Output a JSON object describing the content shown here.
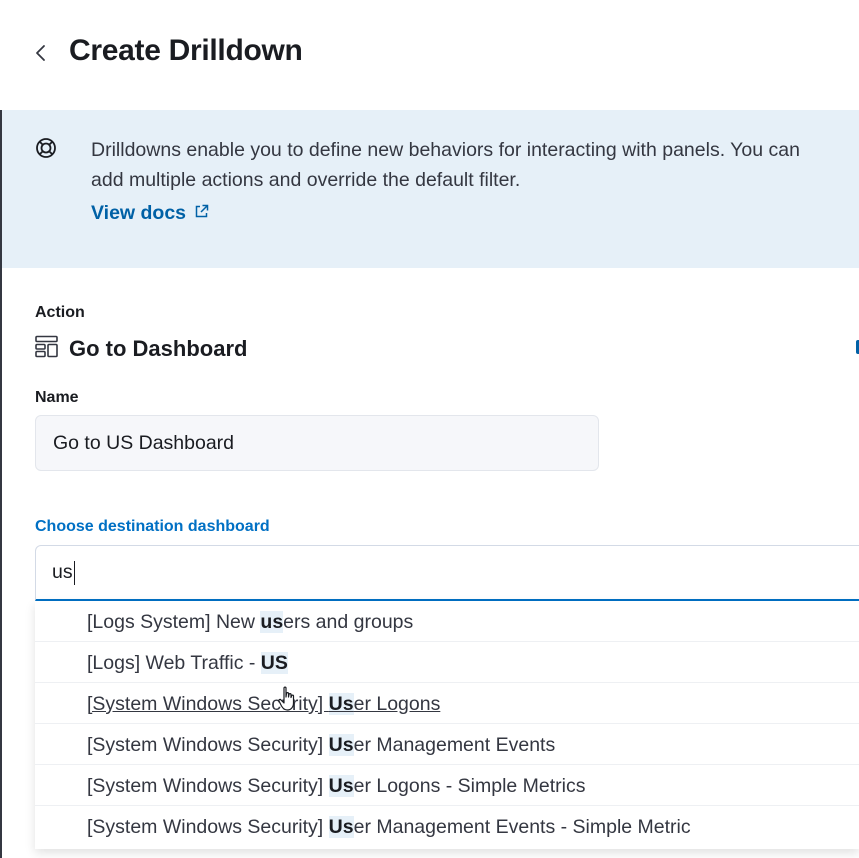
{
  "header": {
    "title": "Create Drilldown"
  },
  "callout": {
    "text": "Drilldowns enable you to define new behaviors for interacting with panels. You can add multiple actions and override the default filter.",
    "link_label": "View docs"
  },
  "action": {
    "label": "Action",
    "name": "Go to Dashboard"
  },
  "name_field": {
    "label": "Name",
    "value": "Go to US Dashboard"
  },
  "destination": {
    "label": "Choose destination dashboard",
    "search_value": "us",
    "options": [
      {
        "prefix": "[Logs System] New ",
        "match": "us",
        "suffix": "ers and groups"
      },
      {
        "prefix": "[Logs] Web Traffic - ",
        "match": "US",
        "suffix": ""
      },
      {
        "prefix": "[System Windows Security] ",
        "match": "Us",
        "suffix": "er Logons"
      },
      {
        "prefix": "[System Windows Security] ",
        "match": "Us",
        "suffix": "er Management Events"
      },
      {
        "prefix": "[System Windows Security] ",
        "match": "Us",
        "suffix": "er Logons - Simple Metrics"
      },
      {
        "prefix": "[System Windows Security] ",
        "match": "Us",
        "suffix": "er Management Events - Simple Metric"
      }
    ]
  },
  "colors": {
    "accent": "#0070c4",
    "link": "#0061a6",
    "callout_bg": "#e6f0f8",
    "highlight_bg": "#e6f0f8"
  },
  "icons": [
    "chevron-left-icon",
    "help-lifebuoy-icon",
    "external-link-icon",
    "dashboard-app-icon",
    "hand-pointer-cursor-icon"
  ]
}
